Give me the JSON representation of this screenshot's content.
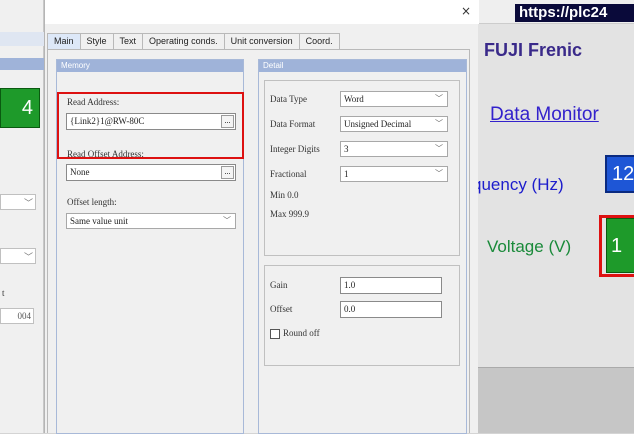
{
  "dialog": {
    "tabs": [
      "Main",
      "Style",
      "Text",
      "Operating conds.",
      "Unit conversion",
      "Coord."
    ],
    "active_tab": "Main",
    "close_glyph": "×"
  },
  "memory": {
    "header": "Memory",
    "read_address_label": "Read Address:",
    "read_address_value": "{Link2}1@RW-80C",
    "read_offset_label": "Read Offset Address:",
    "read_offset_value": "None",
    "offset_length_label": "Offset length:",
    "offset_length_value": "Same value unit",
    "browse_label": "..."
  },
  "detail": {
    "header": "Detail",
    "data_type_label": "Data Type",
    "data_type_value": "Word",
    "data_format_label": "Data Format",
    "data_format_value": "Unsigned Decimal",
    "integer_digits_label": "Integer Digits",
    "integer_digits_value": "3",
    "fractional_label": "Fractional",
    "fractional_value": "1",
    "min_text": "Min 0.0",
    "max_text": "Max 999.9",
    "gain_label": "Gain",
    "gain_value": "1.0",
    "offset_label": "Offset",
    "offset_value": "0.0",
    "round_off_label": "Round off"
  },
  "left_panel": {
    "display_value": "4",
    "field_value": "004",
    "label_fragment": "t"
  },
  "background_app": {
    "url": "https://plc24",
    "title": "FUJI Frenic",
    "link": "Data Monitor",
    "frequency_label": "quency (Hz)",
    "frequency_value": "12",
    "voltage_label": "Voltage (V)",
    "voltage_value": "1"
  }
}
